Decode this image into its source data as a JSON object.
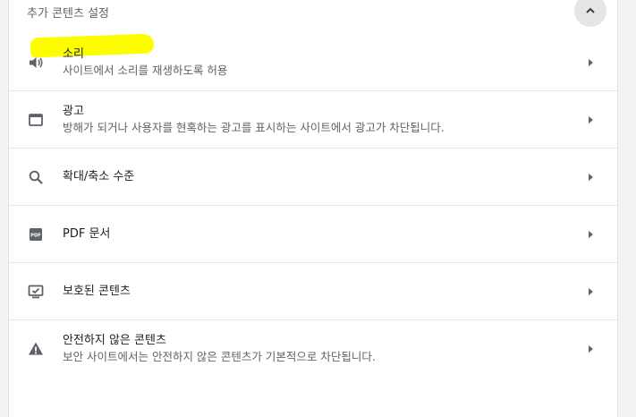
{
  "section": {
    "title": "추가 콘텐츠 설정",
    "collapse_icon": "chevron-up-icon"
  },
  "rows": [
    {
      "icon": "speaker-icon",
      "title": "소리",
      "subtitle": "사이트에서 소리를 재생하도록 허용"
    },
    {
      "icon": "ad-window-icon",
      "title": "광고",
      "subtitle": "방해가 되거나 사용자를 현혹하는 광고를 표시하는 사이트에서 광고가 차단됩니다."
    },
    {
      "icon": "search-icon",
      "title": "확대/축소 수준",
      "subtitle": ""
    },
    {
      "icon": "pdf-icon",
      "title": "PDF 문서",
      "subtitle": ""
    },
    {
      "icon": "protected-content-icon",
      "title": "보호된 콘텐츠",
      "subtitle": ""
    },
    {
      "icon": "warning-icon",
      "title": "안전하지 않은 콘텐츠",
      "subtitle": "보안 사이트에서는 안전하지 않은 콘텐츠가 기본적으로 차단됩니다."
    }
  ],
  "colors": {
    "highlight": "#fdfd00",
    "icon": "#5f6368",
    "background": "#f3f3f3"
  }
}
